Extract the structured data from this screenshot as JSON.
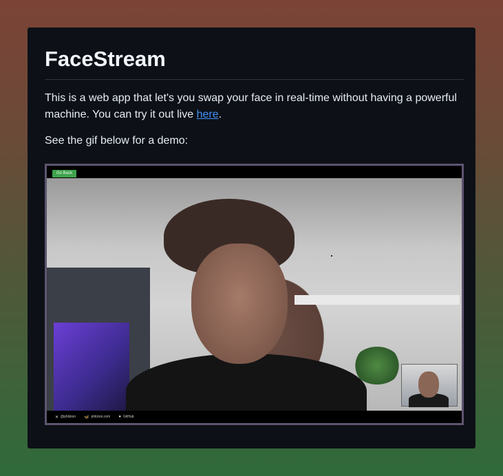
{
  "readme": {
    "title": "FaceStream",
    "intro_text": "This is a web app that let's you swap your face in real-time without having a powerful machine. You can try it out live ",
    "intro_link": "here",
    "intro_end": ".",
    "demo_text": "See the gif below for a demo:"
  },
  "demo": {
    "go_back_label": "Go Back",
    "footer_links": [
      {
        "icon": "x-icon",
        "label": "@philzion"
      },
      {
        "icon": "bluesky-icon",
        "label": "philzion.com"
      },
      {
        "icon": "github-icon",
        "label": "GitHub"
      }
    ]
  }
}
